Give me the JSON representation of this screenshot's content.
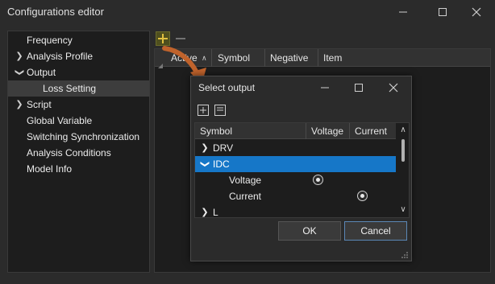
{
  "window": {
    "title": "Configurations editor"
  },
  "sidebar": {
    "items": [
      {
        "label": "Frequency",
        "expandable": false,
        "level": 0
      },
      {
        "label": "Analysis Profile",
        "expandable": true,
        "level": 0
      },
      {
        "label": "Output",
        "expandable": true,
        "expanded": true,
        "level": 0
      },
      {
        "label": "Loss Setting",
        "expandable": false,
        "level": 1,
        "selected": true
      },
      {
        "label": "Script",
        "expandable": true,
        "level": 0
      },
      {
        "label": "Global Variable",
        "expandable": false,
        "level": 0
      },
      {
        "label": "Switching Synchronization",
        "expandable": false,
        "level": 0
      },
      {
        "label": "Analysis Conditions",
        "expandable": false,
        "level": 0
      },
      {
        "label": "Model Info",
        "expandable": false,
        "level": 0
      }
    ]
  },
  "table": {
    "columns": [
      "Active",
      "Symbol",
      "Negative",
      "Item"
    ]
  },
  "dialog": {
    "title": "Select output",
    "columns": [
      "Symbol",
      "Voltage",
      "Current"
    ],
    "rows": [
      {
        "label": "DRV",
        "expandable": true
      },
      {
        "label": "IDC",
        "expandable": true,
        "expanded": true,
        "selected": true
      },
      {
        "label": "Voltage",
        "child": true,
        "selected_column": "Voltage"
      },
      {
        "label": "Current",
        "child": true,
        "selected_column": "Current"
      },
      {
        "label": "L",
        "expandable": true
      }
    ],
    "ok_label": "OK",
    "cancel_label": "Cancel"
  },
  "colors": {
    "selection": "#1677c8",
    "add_icon": "#e0c040",
    "pointer_arrow": "#c0632c"
  }
}
